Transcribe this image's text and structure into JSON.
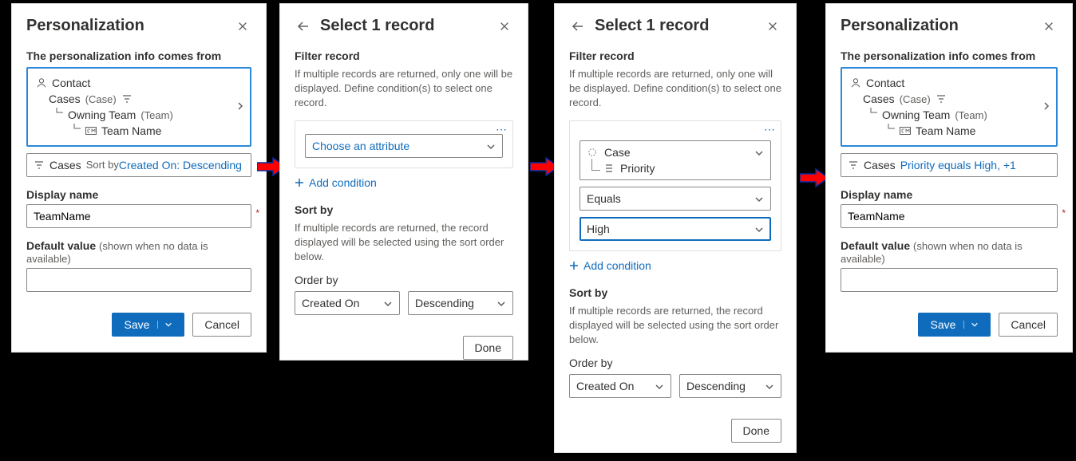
{
  "panel1": {
    "title": "Personalization",
    "info_label": "The personalization info comes from",
    "tree": {
      "root": "Contact",
      "l1": "Cases",
      "l1_type": "(Case)",
      "l2": "Owning Team",
      "l2_type": "(Team)",
      "l3": "Team Name"
    },
    "filter_entity": "Cases",
    "filter_prefix": "Sort by ",
    "filter_value": "Created On: Descending",
    "display_name_label": "Display name",
    "display_name_value": "TeamName",
    "default_label": "Default value",
    "default_hint": "(shown when no data is available)",
    "save": "Save",
    "cancel": "Cancel"
  },
  "panel2": {
    "title": "Select 1 record",
    "filter_h": "Filter record",
    "filter_desc": "If multiple records are returned, only one will be displayed. Define condition(s) to select one record.",
    "choose_attr": "Choose an attribute",
    "add_condition": "Add condition",
    "sort_h": "Sort by",
    "sort_desc": "If multiple records are returned, the record displayed will be selected using the sort order below.",
    "order_label": "Order by",
    "order_by": "Created On",
    "order_dir": "Descending",
    "done": "Done"
  },
  "panel3": {
    "title": "Select 1 record",
    "filter_h": "Filter record",
    "filter_desc": "If multiple records are returned, only one will be displayed. Define condition(s) to select one record.",
    "attr_entity": "Case",
    "attr_field": "Priority",
    "operator": "Equals",
    "value": "High",
    "add_condition": "Add condition",
    "sort_h": "Sort by",
    "sort_desc": "If multiple records are returned, the record displayed will be selected using the sort order below.",
    "order_label": "Order by",
    "order_by": "Created On",
    "order_dir": "Descending",
    "done": "Done"
  },
  "panel4": {
    "title": "Personalization",
    "info_label": "The personalization info comes from",
    "tree": {
      "root": "Contact",
      "l1": "Cases",
      "l1_type": "(Case)",
      "l2": "Owning Team",
      "l2_type": "(Team)",
      "l3": "Team Name"
    },
    "filter_entity": "Cases",
    "filter_value": "Priority equals High, +1",
    "display_name_label": "Display name",
    "display_name_value": "TeamName",
    "default_label": "Default value",
    "default_hint": "(shown when no data is available)",
    "save": "Save",
    "cancel": "Cancel"
  }
}
